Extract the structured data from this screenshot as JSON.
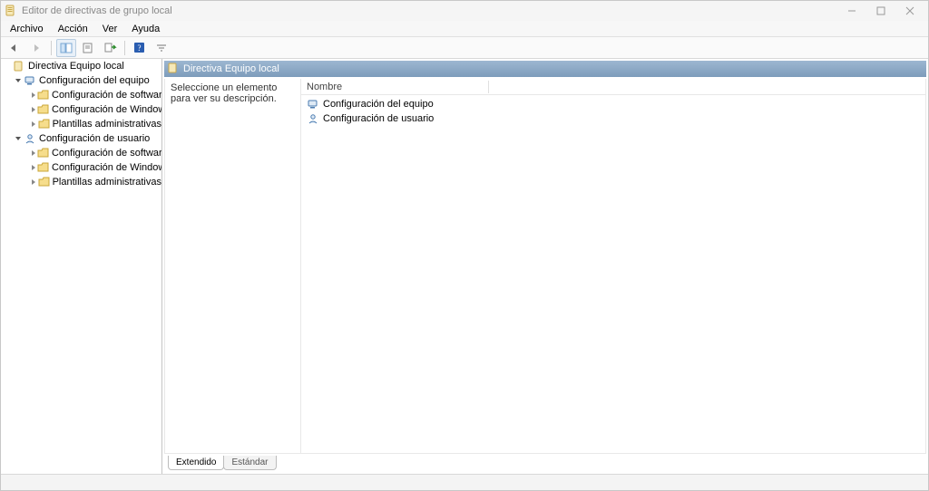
{
  "window": {
    "title": "Editor de directivas de grupo local"
  },
  "menu": {
    "items": [
      "Archivo",
      "Acción",
      "Ver",
      "Ayuda"
    ]
  },
  "tree": {
    "root": "Directiva Equipo local",
    "computer_config": "Configuración del equipo",
    "computer_children": [
      "Configuración de software",
      "Configuración de Windows",
      "Plantillas administrativas"
    ],
    "user_config": "Configuración de usuario",
    "user_children": [
      "Configuración de software",
      "Configuración de Windows",
      "Plantillas administrativas"
    ]
  },
  "content": {
    "header": "Directiva Equipo local",
    "description": "Seleccione un elemento para ver su descripción.",
    "column_name": "Nombre",
    "rows": [
      "Configuración del equipo",
      "Configuración de usuario"
    ]
  },
  "tabs": {
    "extended": "Extendido",
    "standard": "Estándar"
  }
}
